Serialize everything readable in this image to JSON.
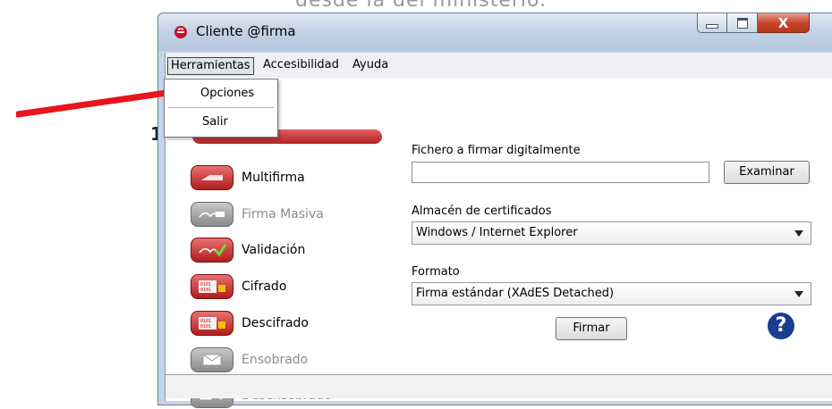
{
  "background": {
    "top_text": "desde la del ministerio.",
    "stray_digit": "1"
  },
  "window": {
    "title": "Cliente @firma",
    "close_glyph": "X"
  },
  "menubar": {
    "items": [
      {
        "label": "Herramientas",
        "active": true
      },
      {
        "label": "Accesibilidad",
        "active": false
      },
      {
        "label": "Ayuda",
        "active": false
      }
    ]
  },
  "dropdown": {
    "items": [
      "Opciones",
      "Salir"
    ]
  },
  "sidebar": {
    "items": [
      {
        "label": "Multifirma",
        "enabled": true,
        "icon": "multisign-icon",
        "color": "red"
      },
      {
        "label": "Firma Masiva",
        "enabled": false,
        "icon": "mass-sign-icon",
        "color": "gray"
      },
      {
        "label": "Validación",
        "enabled": true,
        "icon": "validation-icon",
        "color": "red"
      },
      {
        "label": "Cifrado",
        "enabled": true,
        "icon": "encrypt-icon",
        "color": "red"
      },
      {
        "label": "Descifrado",
        "enabled": true,
        "icon": "decrypt-icon",
        "color": "red"
      },
      {
        "label": "Ensobrado",
        "enabled": false,
        "icon": "envelope-icon",
        "color": "gray"
      },
      {
        "label": "Desensobrado",
        "enabled": false,
        "icon": "unenvelope-icon",
        "color": "gray"
      }
    ]
  },
  "form": {
    "file_label": "Fichero a firmar digitalmente",
    "file_value": "",
    "browse_button": "Examinar",
    "store_label": "Almacén de certificados",
    "store_value": "Windows / Internet Explorer",
    "format_label": "Formato",
    "format_value": "Firma estándar (XAdES Detached)",
    "sign_button": "Firmar",
    "help_glyph": "?"
  },
  "colors": {
    "accent_red": "#c0392b",
    "help_blue": "#1a3d8f",
    "arrow_red": "#e8141e"
  }
}
